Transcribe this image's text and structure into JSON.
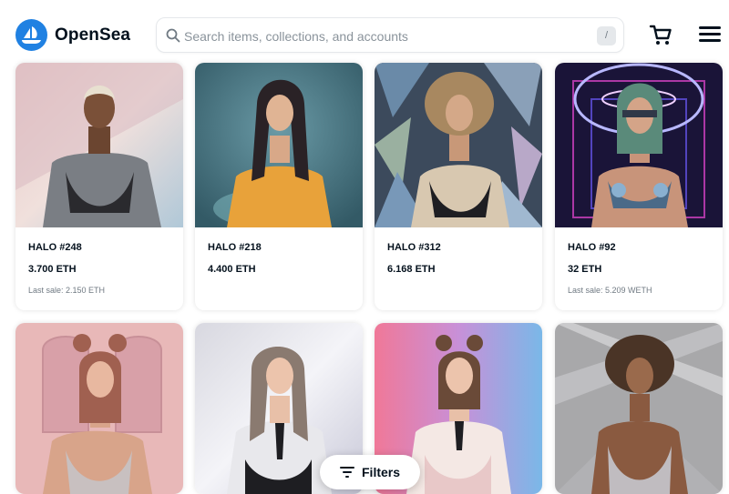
{
  "header": {
    "brand": "OpenSea",
    "search_placeholder": "Search items, collections, and accounts",
    "search_shortcut": "/"
  },
  "items": [
    {
      "name": "HALO #248",
      "price": "3.700 ETH",
      "last_sale": "Last sale: 2.150 ETH"
    },
    {
      "name": "HALO #218",
      "price": "4.400 ETH",
      "last_sale": ""
    },
    {
      "name": "HALO #312",
      "price": "6.168 ETH",
      "last_sale": ""
    },
    {
      "name": "HALO #92",
      "price": "32 ETH",
      "last_sale": "Last sale: 5.209 WETH"
    },
    {
      "name": "",
      "price": "",
      "last_sale": ""
    },
    {
      "name": "",
      "price": "",
      "last_sale": ""
    },
    {
      "name": "",
      "price": "",
      "last_sale": ""
    },
    {
      "name": "",
      "price": "",
      "last_sale": ""
    }
  ],
  "filters_label": "Filters",
  "colors": {
    "brand_blue": "#2081e2",
    "text_primary": "#04111d",
    "text_secondary": "#707a83"
  }
}
